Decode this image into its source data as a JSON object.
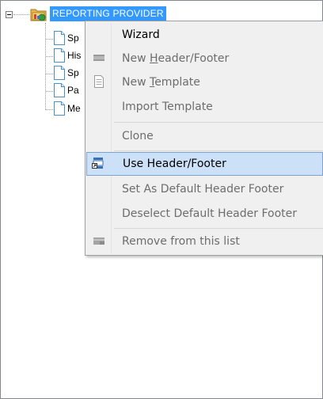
{
  "tree": {
    "root": {
      "label": "REPORTING PROVIDER",
      "expanded": true
    },
    "children": [
      {
        "label": "Sp"
      },
      {
        "label": "His"
      },
      {
        "label": "Sp"
      },
      {
        "label": "Pa"
      },
      {
        "label": "Me"
      }
    ]
  },
  "context_menu": {
    "items": [
      {
        "label": "Wizard",
        "enabled": true,
        "icon": "none"
      },
      {
        "label_pre": "New ",
        "label_ul": "H",
        "label_post": "eader/Footer",
        "enabled": false,
        "icon": "header-footer-icon"
      },
      {
        "label_pre": "New ",
        "label_ul": "T",
        "label_post": "emplate",
        "enabled": false,
        "icon": "template-icon"
      },
      {
        "label": "Import Template",
        "enabled": false,
        "icon": "none"
      },
      {
        "label": "Clone",
        "enabled": false,
        "icon": "none"
      },
      {
        "label": "Use Header/Footer",
        "enabled": true,
        "highlighted": true,
        "icon": "use-header-footer-icon"
      },
      {
        "label": "Set As Default Header Footer",
        "enabled": false,
        "icon": "none"
      },
      {
        "label": "Deselect Default Header Footer",
        "enabled": false,
        "icon": "none"
      },
      {
        "label": "Remove from this list",
        "enabled": false,
        "icon": "remove-list-icon"
      }
    ]
  },
  "colors": {
    "selection": "#3399ff",
    "menu_background": "#f0f0f0",
    "menu_highlight": "#cce0f7",
    "menu_highlight_border": "#7da2ce",
    "disabled_text": "#6d6d6d"
  }
}
